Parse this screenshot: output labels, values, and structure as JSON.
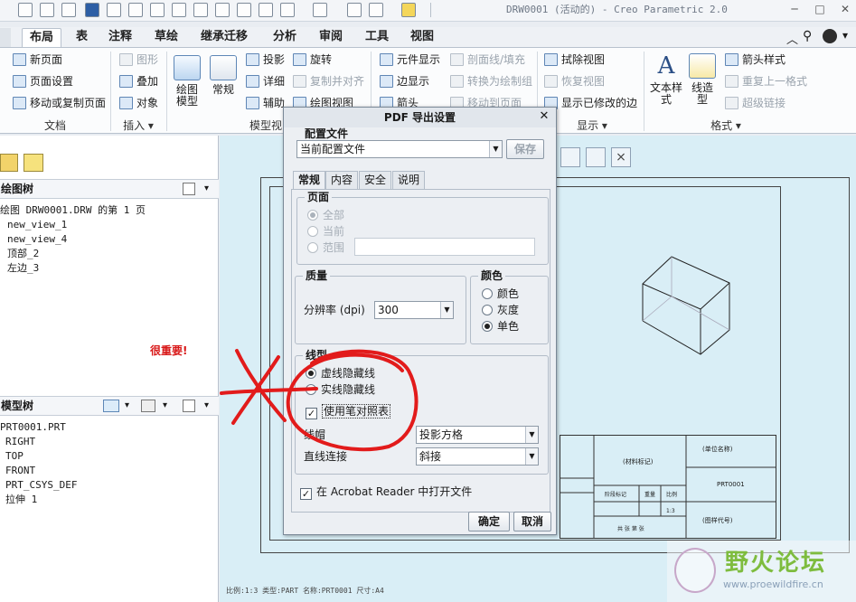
{
  "window": {
    "title": "DRW0001 (活动的) - Creo Parametric 2.0",
    "colors": {
      "accent": "#2f6db5",
      "annotation": "#e21b1b",
      "canvas": "#d9eef6",
      "dialog": "#eceff3"
    }
  },
  "ribbon": {
    "tabs": [
      "布局",
      "表",
      "注释",
      "草绘",
      "继承迁移",
      "分析",
      "审阅",
      "工具",
      "视图"
    ],
    "active_tab": "布局",
    "doc_group": {
      "items": [
        "新页面",
        "页面设置",
        "移动或复制页面"
      ],
      "label": "文档"
    },
    "insert_group": {
      "items": [
        "图形",
        "叠加",
        "对象"
      ],
      "label": "插入"
    },
    "model_group": {
      "buttons": [
        "绘图模型",
        "常规"
      ],
      "items": [
        "投影",
        "详细",
        "辅助",
        "旋转",
        "复制并对齐",
        "绘图视图"
      ],
      "label": "模型视图"
    },
    "edit_group": {
      "items": [
        "元件显示",
        "边显示",
        "箭头",
        "剖面线/填充",
        "转换为绘制组",
        "移动到页面"
      ]
    },
    "display_group": {
      "items": [
        "拭除视图",
        "恢复视图",
        "显示已修改的边"
      ],
      "label": "显示"
    },
    "format_group": {
      "buttons": [
        "文本样式",
        "线造型"
      ],
      "items": [
        "箭头样式",
        "重复上一格式",
        "超级链接"
      ],
      "label": "格式"
    }
  },
  "left_panel": {
    "drawing_tree": {
      "title": "绘图树",
      "items": [
        "绘图 DRW0001.DRW 的第 1 页",
        "new_view_1",
        "new_view_4",
        "顶部_2",
        "左边_3"
      ]
    },
    "annotation_note": "很重要!",
    "model_tree": {
      "title": "模型树",
      "items": [
        "PRT0001.PRT",
        "RIGHT",
        "TOP",
        "FRONT",
        "PRT_CSYS_DEF",
        "拉伸 1"
      ]
    }
  },
  "drawing": {
    "status": "比例:1:3    类型:PART  名称:PRT0001  尺寸:A4",
    "title_block": [
      "(单位名称)",
      "(材料标记)",
      "PRT0001",
      "(图样代号)",
      "阶段标记",
      "重量",
      "比例",
      "1:3",
      "共 张 第 张"
    ]
  },
  "dialog": {
    "title": "PDF 导出设置",
    "profile": {
      "label": "配置文件",
      "value": "当前配置文件",
      "save_label": "保存"
    },
    "tabs": [
      "常规",
      "内容",
      "安全",
      "说明"
    ],
    "active_tab": "常规",
    "page": {
      "label": "页面",
      "options": [
        "全部",
        "当前",
        "范围"
      ],
      "selected": "全部",
      "range_value": ""
    },
    "quality": {
      "label": "质量",
      "resolution_label": "分辨率 (dpi)",
      "resolution": "300"
    },
    "color": {
      "label": "颜色",
      "options": [
        "颜色",
        "灰度",
        "单色"
      ],
      "selected": "单色"
    },
    "linestyle": {
      "label": "线型",
      "options": [
        "虚线隐藏线",
        "实线隐藏线"
      ],
      "selected": "虚线隐藏线",
      "pen_table_label": "使用笔对照表",
      "pen_table_checked": true,
      "cap_label": "线帽",
      "cap_value": "投影方格",
      "join_label": "直线连接",
      "join_value": "斜接"
    },
    "open_in_reader": {
      "label": "在 Acrobat Reader 中打开文件",
      "checked": true
    },
    "ok_label": "确定",
    "cancel_label": "取消"
  },
  "watermark": {
    "title": "野火论坛",
    "url": "www.proewildfire.cn"
  }
}
